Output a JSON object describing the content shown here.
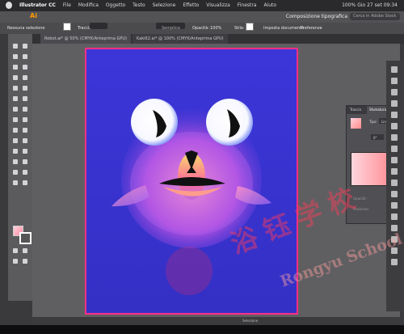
{
  "menu": {
    "app": "Illustrator CC",
    "items": [
      "File",
      "Modifica",
      "Oggetto",
      "Testo",
      "Selezione",
      "Effetto",
      "Visualizza",
      "Finestra",
      "Aiuto"
    ],
    "status": "Gio 27 set 09:34",
    "battery": "100%"
  },
  "app_bar": {
    "logo": "Ai",
    "workspace": "Composizione tipografica",
    "search_placeholder": "Cerca in Adobe Stock"
  },
  "control": {
    "selection": "Nessuna selezione",
    "stroke_label": "Traccia:",
    "brush": "Semplice",
    "opacity_label": "Opacità:",
    "opacity_value": "100%",
    "style_label": "Stile:",
    "document": "Imposta documento",
    "preferences": "Preferenze"
  },
  "tabs": [
    "Robot.ai* @ 50% (CMYK/Anteprima GPU)",
    "Kaki62.ai* @ 100% (CMYK/Anteprima GPU)"
  ],
  "panel": {
    "tabs": [
      "Traccia",
      "Sfumatura",
      "Trasparen"
    ],
    "type_label": "Tipo:",
    "type_value": "Lineare",
    "angle": "0°",
    "opacity_label": "Opacità:",
    "position_label": "Posizione:"
  },
  "status": {
    "selection": "Selezione"
  },
  "watermark": {
    "chars": [
      "浴",
      "钰",
      "学",
      "校"
    ],
    "latin": "Rongyu School"
  },
  "colors": {
    "artboard": "#3b35d6",
    "artboard_border": "#ff2f83",
    "gradient_start": "#ffd5dc",
    "gradient_end": "#ff6f77"
  }
}
